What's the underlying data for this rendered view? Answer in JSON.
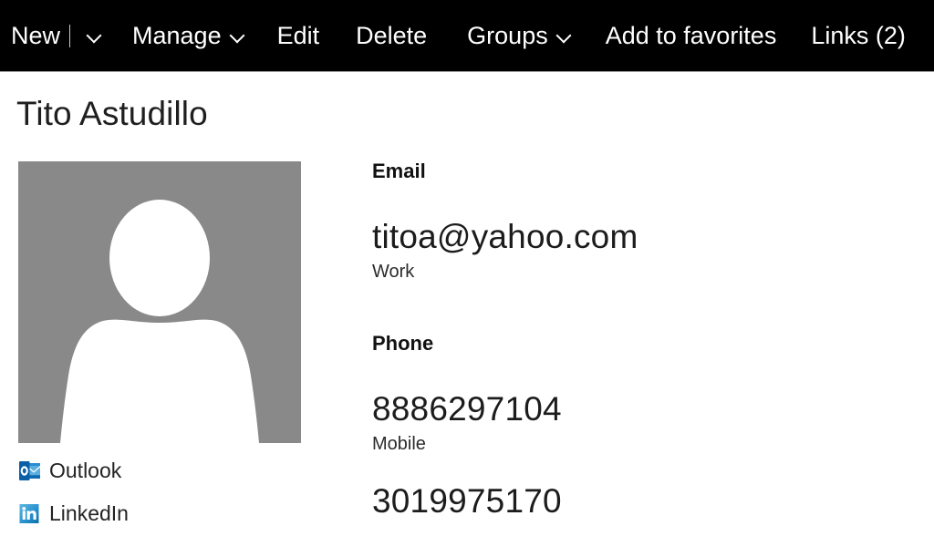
{
  "commandbar": {
    "items": [
      {
        "label": "New",
        "has_separator": true,
        "has_chevron": true,
        "name": "new"
      },
      {
        "label": "Manage",
        "has_separator": false,
        "has_chevron": true,
        "name": "manage"
      },
      {
        "label": "Edit",
        "has_separator": false,
        "has_chevron": false,
        "name": "edit"
      },
      {
        "label": "Delete",
        "has_separator": false,
        "has_chevron": false,
        "name": "delete"
      },
      {
        "label": "Groups",
        "has_separator": false,
        "has_chevron": true,
        "name": "groups"
      },
      {
        "label": "Add to favorites",
        "has_separator": false,
        "has_chevron": false,
        "name": "add-to-favorites"
      },
      {
        "label": "Links (2)",
        "has_separator": false,
        "has_chevron": false,
        "name": "links"
      }
    ],
    "background_color": "#000000",
    "text_color": "#ffffff"
  },
  "contact": {
    "name": "Tito Astudillo",
    "avatar": {
      "kind": "placeholder-person",
      "background_color": "#898989",
      "silhouette_color": "#ffffff"
    },
    "links": [
      {
        "label": "Outlook",
        "icon": "outlook-icon",
        "color": "#0072c6"
      },
      {
        "label": "LinkedIn",
        "icon": "linkedin-icon",
        "color": "#0e76a8"
      }
    ],
    "sections": [
      {
        "heading": "Email",
        "fields": [
          {
            "value": "titoa@yahoo.com",
            "sublabel": "Work"
          }
        ]
      },
      {
        "heading": "Phone",
        "fields": [
          {
            "value": "8886297104",
            "sublabel": "Mobile"
          },
          {
            "value": "3019975170",
            "sublabel": ""
          }
        ]
      }
    ]
  }
}
